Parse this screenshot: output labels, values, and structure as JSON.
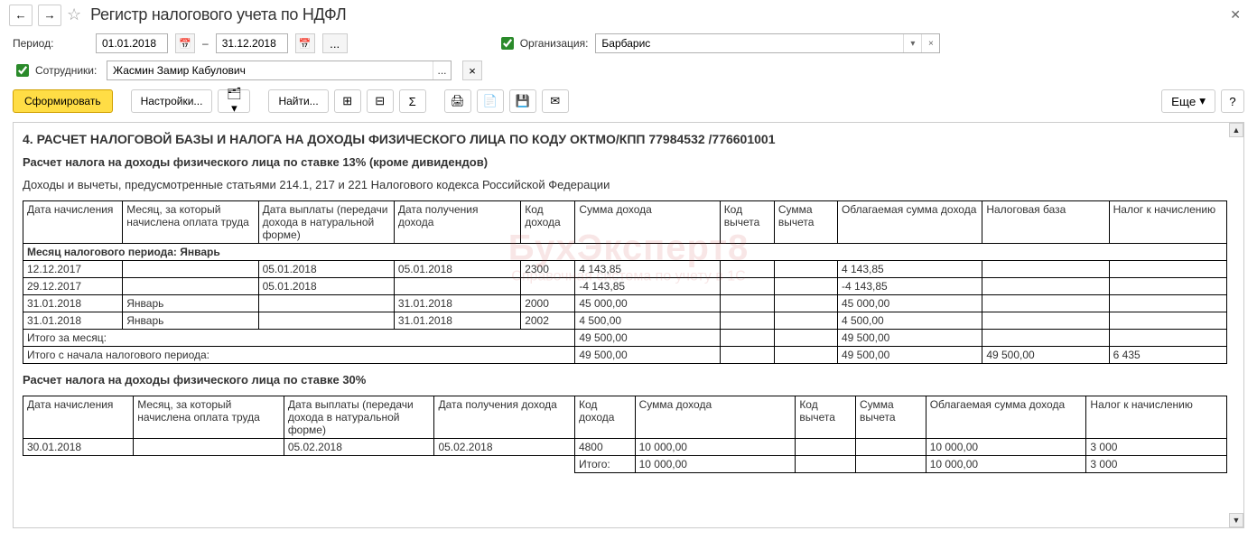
{
  "header": {
    "title": "Регистр налогового учета по НДФЛ"
  },
  "filters": {
    "period_label": "Период:",
    "date_from": "01.01.2018",
    "date_to": "31.12.2018",
    "date_sep": "–",
    "org_label": "Организация:",
    "org_value": "Барбарис",
    "emp_label": "Сотрудники:",
    "emp_value": "Жасмин Замир Кабулович"
  },
  "toolbar": {
    "generate": "Сформировать",
    "settings": "Настройки...",
    "find": "Найти...",
    "more": "Еще",
    "help": "?"
  },
  "report": {
    "section_title": "4. РАСЧЕТ НАЛОГОВОЙ БАЗЫ И НАЛОГА НА ДОХОДЫ ФИЗИЧЕСКОГО ЛИЦА ПО КОДУ ОКТМО/КПП 77984532   /776601001",
    "sub1_title": "Расчет налога на доходы физического лица по ставке 13% (кроме дивидендов)",
    "note": "Доходы и вычеты, предусмотренные статьями 214.1, 217 и 221 Налогового кодекса Российской Федерации",
    "cols": {
      "c0": "Дата начисления",
      "c1": "Месяц, за который начислена оплата труда",
      "c2": "Дата выплаты (передачи дохода в натуральной форме)",
      "c3": "Дата получения дохода",
      "c4": "Код дохода",
      "c5": "Сумма дохода",
      "c6": "Код вычета",
      "c7": "Сумма вычета",
      "c8": "Облагаемая сумма дохода",
      "c9": "Налоговая база",
      "c10": "Налог к начислению"
    },
    "group_label": "Месяц налогового периода: Январь",
    "rows13": [
      {
        "c0": "12.12.2017",
        "c1": "",
        "c2": "05.01.2018",
        "c3": "05.01.2018",
        "c4": "2300",
        "c5": "4 143,85",
        "c6": "",
        "c7": "",
        "c8": "4 143,85",
        "c9": "",
        "c10": ""
      },
      {
        "c0": "29.12.2017",
        "c1": "",
        "c2": "05.01.2018",
        "c3": "",
        "c4": "",
        "c5": "-4 143,85",
        "c6": "",
        "c7": "",
        "c8": "-4 143,85",
        "c9": "",
        "c10": ""
      },
      {
        "c0": "31.01.2018",
        "c1": "Январь",
        "c2": "",
        "c3": "31.01.2018",
        "c4": "2000",
        "c5": "45 000,00",
        "c6": "",
        "c7": "",
        "c8": "45 000,00",
        "c9": "",
        "c10": ""
      },
      {
        "c0": "31.01.2018",
        "c1": "Январь",
        "c2": "",
        "c3": "31.01.2018",
        "c4": "2002",
        "c5": "4 500,00",
        "c6": "",
        "c7": "",
        "c8": "4 500,00",
        "c9": "",
        "c10": ""
      }
    ],
    "total_month_label": "Итого за месяц:",
    "total_month": {
      "c5": "49 500,00",
      "c8": "49 500,00"
    },
    "total_period_label": "Итого с начала налогового периода:",
    "total_period": {
      "c5": "49 500,00",
      "c8": "49 500,00",
      "c9": "49 500,00",
      "c10": "6 435"
    },
    "sub2_title": "Расчет налога на доходы физического лица по ставке 30%",
    "rows30": [
      {
        "c0": "30.01.2018",
        "c1": "",
        "c2": "05.02.2018",
        "c3": "05.02.2018",
        "c4": "4800",
        "c5": "10 000,00",
        "c6": "",
        "c7": "",
        "c8": "10 000,00",
        "c9": "",
        "c10": "3 000"
      }
    ],
    "total30_label": "Итого:",
    "total30": {
      "c5": "10 000,00",
      "c8": "10 000,00",
      "c10": "3 000"
    }
  },
  "watermark": {
    "big": "БухЭксперт8",
    "small": "Справочная система по учету в 1С"
  }
}
